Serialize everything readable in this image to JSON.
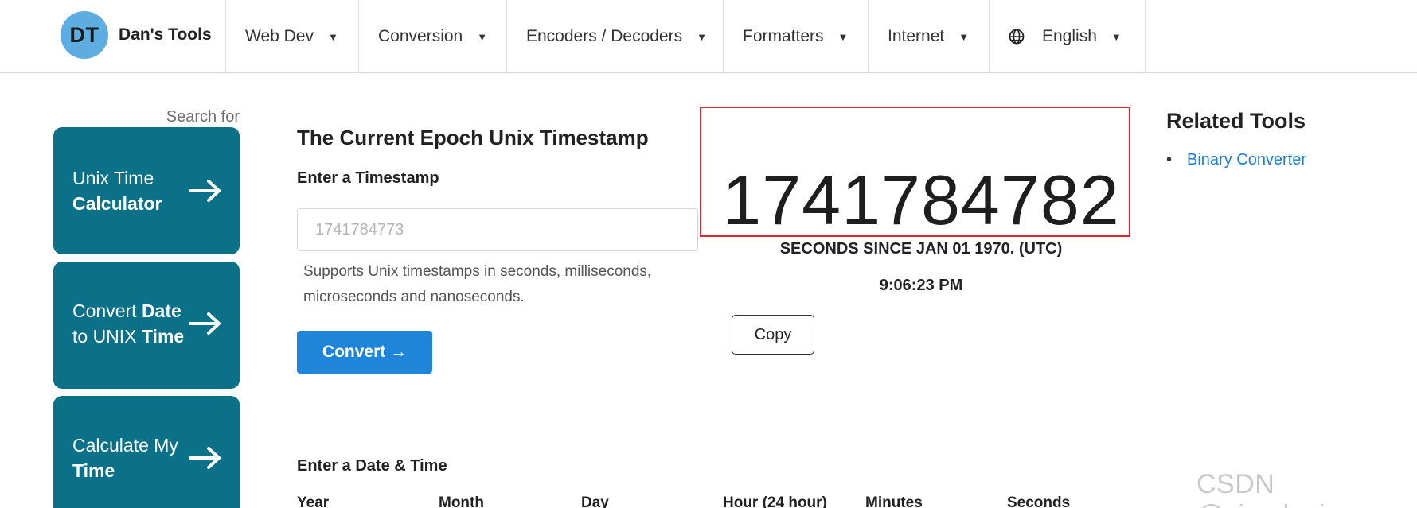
{
  "brand": {
    "logo_text": "DT",
    "name": "Dan's Tools"
  },
  "nav": {
    "items": [
      {
        "label": "Web Dev"
      },
      {
        "label": "Conversion"
      },
      {
        "label": "Encoders / Decoders"
      },
      {
        "label": "Formatters"
      },
      {
        "label": "Internet"
      },
      {
        "label": "English",
        "icon": "globe-icon"
      }
    ]
  },
  "sidebar": {
    "search_label": "Search for",
    "tiles": [
      {
        "line1": "Unix Time",
        "line2_bold": "Calculator"
      },
      {
        "line1_plain": "Convert ",
        "line1_bold": "Date",
        "line2_plain": "to UNIX ",
        "line2_bold": "Time"
      },
      {
        "line1": "Calculate My",
        "line2_bold": "Time"
      }
    ]
  },
  "main": {
    "title": "The Current Epoch Unix Timestamp",
    "timestamp_label": "Enter a Timestamp",
    "timestamp_placeholder": "1741784773",
    "help_text": "Supports Unix timestamps in seconds, milliseconds, microseconds and nanoseconds.",
    "convert_label": "Convert →",
    "datetime_label": "Enter a Date & Time",
    "columns": [
      "Year",
      "Month",
      "Day",
      "Hour (24 hour)",
      "Minutes",
      "Seconds"
    ]
  },
  "current": {
    "timestamp": "1741784782",
    "caption": "SECONDS SINCE JAN 01 1970. (UTC)",
    "time": "9:06:23 PM",
    "copy_label": "Copy",
    "highlight_color": "#d9262e"
  },
  "related": {
    "title": "Related Tools",
    "items": [
      {
        "label": "Binary Converter"
      }
    ]
  },
  "colors": {
    "accent": "#1e85d8",
    "tile": "#0a7189",
    "link": "#1e7fce",
    "logo": "#5dade2"
  },
  "watermark": "CSDN @simplesin"
}
